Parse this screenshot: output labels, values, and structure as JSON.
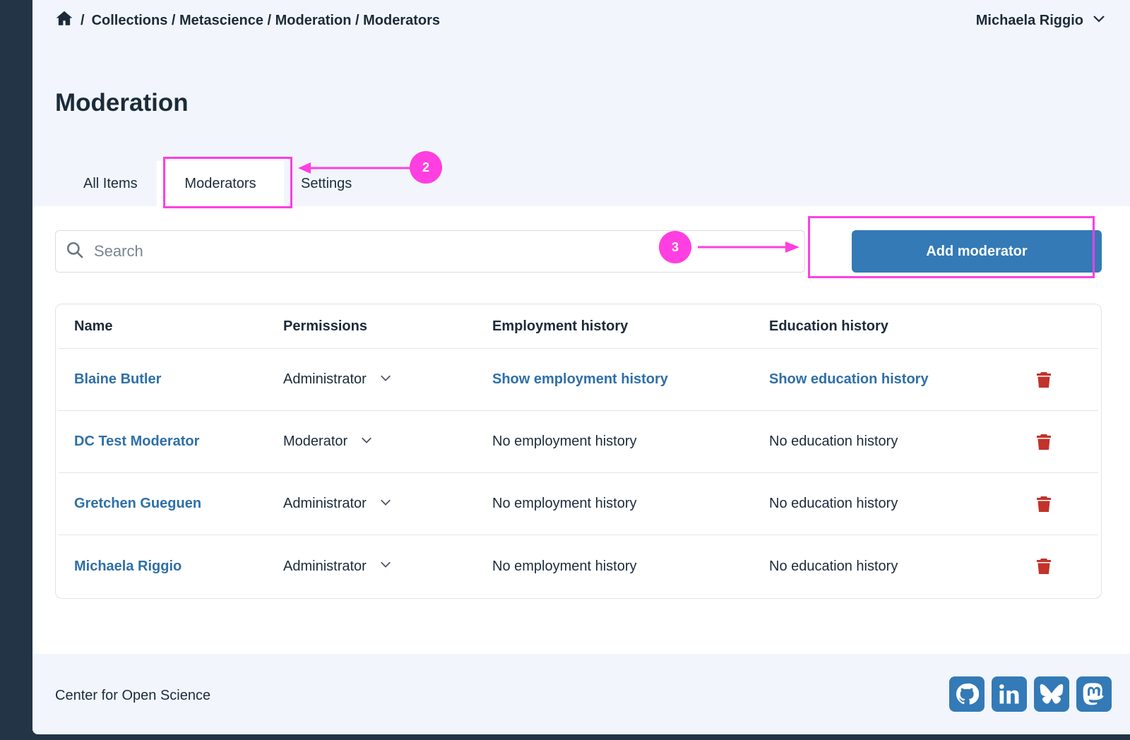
{
  "breadcrumb": {
    "separator": "/",
    "path": "Collections / Metascience / Moderation / Moderators"
  },
  "user": {
    "name": "Michaela Riggio"
  },
  "page": {
    "title": "Moderation"
  },
  "tabs": [
    {
      "label": "All Items"
    },
    {
      "label": "Moderators"
    },
    {
      "label": "Settings"
    }
  ],
  "search": {
    "placeholder": "Search",
    "value": ""
  },
  "add_button": {
    "label": "Add moderator"
  },
  "table": {
    "headers": [
      "Name",
      "Permissions",
      "Employment history",
      "Education history"
    ],
    "rows": [
      {
        "name": "Blaine Butler",
        "permission": "Administrator",
        "employment": "Show employment history",
        "education": "Show education history"
      },
      {
        "name": "DC Test Moderator",
        "permission": "Moderator",
        "employment": "No employment history",
        "education": "No education history"
      },
      {
        "name": "Gretchen Gueguen",
        "permission": "Administrator",
        "employment": "No employment history",
        "education": "No education history"
      },
      {
        "name": "Michaela Riggio",
        "permission": "Administrator",
        "employment": "No employment history",
        "education": "No education history"
      }
    ]
  },
  "footer": {
    "text": "Center for Open Science"
  },
  "socials": [
    "github-icon",
    "linkedin-icon",
    "bluesky-icon",
    "mastodon-icon"
  ],
  "annotations": {
    "step_a": "2",
    "step_b": "3"
  },
  "colors": {
    "accent": "#337ab7",
    "link": "#2f6fa8",
    "danger": "#c2332a",
    "annotation": "#ff3fe0"
  }
}
